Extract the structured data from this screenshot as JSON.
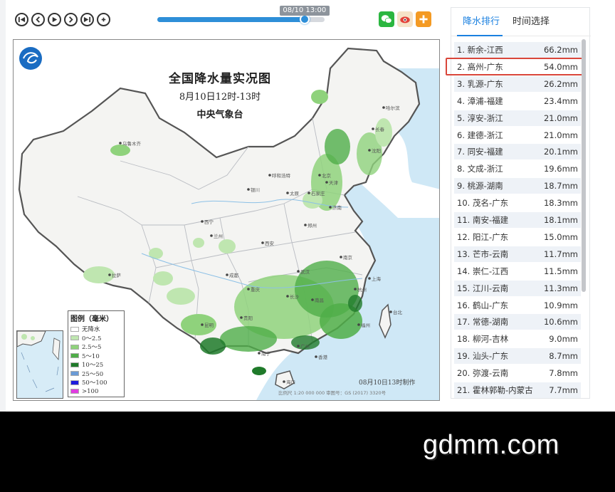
{
  "toolbar": {
    "slider_tooltip": "08/10 13:00",
    "slider_progress": 0.88,
    "share_icons": [
      "wechat-icon",
      "weibo-eye-icon",
      "plus-icon"
    ]
  },
  "map": {
    "title": "全国降水量实况图",
    "time_range": "8月10日12时-13时",
    "issuer": "中央气象台",
    "legend_title": "图例（毫米）",
    "legend": [
      {
        "label": "无降水",
        "color": "#ffffff"
      },
      {
        "label": "0～2.5",
        "color": "#bfe6b0"
      },
      {
        "label": "2.5～5",
        "color": "#8fd27c"
      },
      {
        "label": "5～10",
        "color": "#4fae48"
      },
      {
        "label": "10～25",
        "color": "#1f7a2a"
      },
      {
        "label": "25～50",
        "color": "#6a9bd6"
      },
      {
        "label": "50～100",
        "color": "#1d1ddc"
      },
      {
        "label": ">100",
        "color": "#e03ce0"
      }
    ],
    "footer_note": "08月10日13时制作",
    "scale_note": "比例尺 1:20 000 000    审图号：GS (2017) 3320号",
    "cities": [
      {
        "name": "乌鲁木齐"
      },
      {
        "name": "拉萨"
      },
      {
        "name": "西宁"
      },
      {
        "name": "兰州"
      },
      {
        "name": "银川"
      },
      {
        "name": "呼和浩特"
      },
      {
        "name": "北京"
      },
      {
        "name": "天津"
      },
      {
        "name": "石家庄"
      },
      {
        "name": "太原"
      },
      {
        "name": "济南"
      },
      {
        "name": "郑州"
      },
      {
        "name": "西安"
      },
      {
        "name": "成都"
      },
      {
        "name": "重庆"
      },
      {
        "name": "武汉"
      },
      {
        "name": "长沙"
      },
      {
        "name": "南昌"
      },
      {
        "name": "杭州"
      },
      {
        "name": "上海"
      },
      {
        "name": "南京"
      },
      {
        "name": "福州"
      },
      {
        "name": "广州"
      },
      {
        "name": "南宁"
      },
      {
        "name": "贵阳"
      },
      {
        "name": "昆明"
      },
      {
        "name": "海口"
      },
      {
        "name": "沈阳"
      },
      {
        "name": "长春"
      },
      {
        "name": "哈尔滨"
      },
      {
        "name": "香港"
      },
      {
        "name": "台北"
      }
    ]
  },
  "rankings": {
    "tabs": [
      "降水排行",
      "时间选择"
    ],
    "active_tab": 0,
    "highlight_index": 1,
    "items": [
      {
        "name": "1. 新余-江西",
        "value": "66.2mm"
      },
      {
        "name": "2. 高州-广东",
        "value": "54.0mm"
      },
      {
        "name": "3. 乳源-广东",
        "value": "26.2mm"
      },
      {
        "name": "4. 漳浦-福建",
        "value": "23.4mm"
      },
      {
        "name": "5. 淳安-浙江",
        "value": "21.0mm"
      },
      {
        "name": "6. 建德-浙江",
        "value": "21.0mm"
      },
      {
        "name": "7. 同安-福建",
        "value": "20.1mm"
      },
      {
        "name": "8. 文成-浙江",
        "value": "19.6mm"
      },
      {
        "name": "9. 桃源-湖南",
        "value": "18.7mm"
      },
      {
        "name": "10. 茂名-广东",
        "value": "18.3mm"
      },
      {
        "name": "11. 南安-福建",
        "value": "18.1mm"
      },
      {
        "name": "12. 阳江-广东",
        "value": "15.0mm"
      },
      {
        "name": "13. 芒市-云南",
        "value": "11.7mm"
      },
      {
        "name": "14. 崇仁-江西",
        "value": "11.5mm"
      },
      {
        "name": "15. 江川-云南",
        "value": "11.3mm"
      },
      {
        "name": "16. 鹤山-广东",
        "value": "10.9mm"
      },
      {
        "name": "17. 常德-湖南",
        "value": "10.6mm"
      },
      {
        "name": "18. 柳河-吉林",
        "value": "9.0mm"
      },
      {
        "name": "19. 汕头-广东",
        "value": "8.7mm"
      },
      {
        "name": "20. 弥渡-云南",
        "value": "7.8mm"
      },
      {
        "name": "21. 霍林郭勒-内蒙古",
        "value": "7.7mm"
      }
    ]
  },
  "watermark": "gdmm.com"
}
